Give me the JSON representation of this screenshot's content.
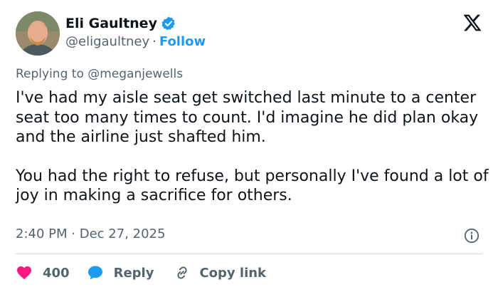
{
  "author": {
    "display_name": "Eli Gaultney",
    "handle": "@eligaultney",
    "separator": "·",
    "follow_label": "Follow",
    "verified": true
  },
  "reply_context": {
    "prefix": "Replying to",
    "mention": "@meganjewells"
  },
  "post": {
    "paragraphs": [
      "I've had my aisle seat get switched last minute to a center seat too many times to count. I'd imagine he did plan okay and the airline just shafted him.",
      "You had the right to refuse, but personally I've found a lot of joy in making a sacrifice for others."
    ],
    "time": "2:40 PM",
    "date_separator": "·",
    "date": "Dec 27, 2025"
  },
  "actions": {
    "like_count": "400",
    "reply_label": "Reply",
    "copy_label": "Copy link"
  },
  "icons": {
    "brand": "x-logo-icon",
    "verified": "verified-badge-icon",
    "info": "info-icon",
    "like": "heart-icon",
    "reply": "speech-bubble-icon",
    "copy": "link-icon"
  },
  "colors": {
    "accent": "#1d9bf0",
    "text": "#0f1419",
    "muted": "#536471",
    "like": "#f91880",
    "divider": "#cfd9de"
  }
}
